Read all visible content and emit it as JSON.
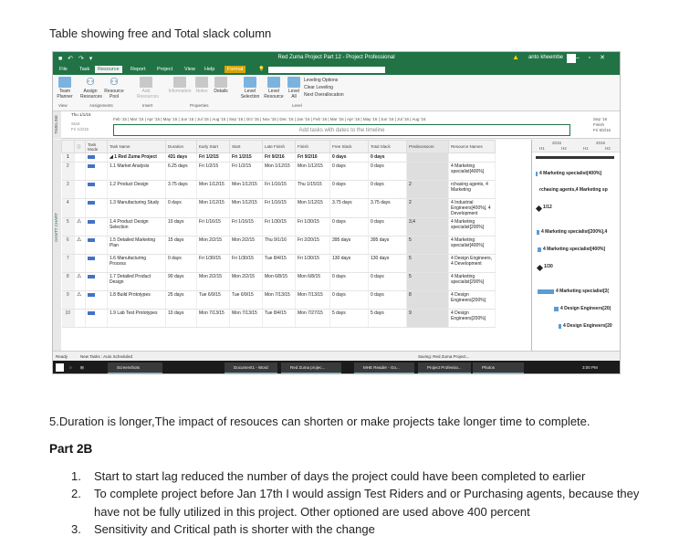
{
  "doc": {
    "title": "Table showing free and Total slack column",
    "question5": "5.Duration is longer,The impact of resouces can shorten or make projects take longer time to complete.",
    "part_heading": "Part 2B",
    "answers": [
      {
        "num": "1.",
        "text": "Start to start lag reduced the number of days the project could have been completed to earlier"
      },
      {
        "num": "2.",
        "text": "To complete project before Jan 17th I would assign Test Riders and or Purchasing agents, because  they have not be fully utilized in this project. Other optioned are used above 400 percent"
      },
      {
        "num": "3.",
        "text": "Sensitivity and Critical path is shorter with the change"
      }
    ]
  },
  "project": {
    "window_title": "Red Zuma Project Part 12 - Project Professional",
    "user": "anto kheembe",
    "menu": [
      "File",
      "Task",
      "Resource",
      "Report",
      "Project",
      "View",
      "Help",
      "Format"
    ],
    "ribbon": {
      "buttons": [
        "Team Planner",
        "Assign Resources",
        "Resource Pool",
        "Add Resources",
        "Information",
        "Notes",
        "Details",
        "Level Selection",
        "Level Resource",
        "Level All"
      ],
      "leveling": [
        "Leveling Options",
        "Clear Leveling",
        "Next Overallocation"
      ],
      "groups": [
        "View",
        "Assignments",
        "Insert",
        "Properties",
        "Level"
      ]
    },
    "timeline": {
      "side_label": "TIMELINE",
      "today": "Thu 1/1/15",
      "start_label": "Start",
      "start_date": "Fri 1/2/15",
      "scale": "Feb '15 | Mar '15 | Apr '15 | May '15 | Jun '15 | Jul '15 | Aug '15 | Sep '15 | Oct '15 | Nov '15 | Dec '15 | Jan '16 | Feb '16 | Mar '16 | Apr '16 | May '16 | Jun '16 | Jul '16 | Aug '16",
      "placeholder": "Add tasks with dates to the timeline",
      "finish_month": "Sep '16",
      "finish_label": "Finish",
      "finish_date": "Fri 9/2/16"
    },
    "gantt_side_label": "GANTT CHART",
    "columns": [
      "",
      "",
      "Task Mode",
      "Task Name",
      "Duration",
      "Early Start",
      "Start",
      "Late Finish",
      "Finish",
      "Free Slack",
      "Total Slack",
      "Predecessors",
      "Resource Names"
    ],
    "rows": [
      {
        "id": "1",
        "ind": "",
        "name": "◢ 1 Red Zuma Project",
        "dur": "431 days",
        "es": "Fri 1/2/15",
        "start": "Fri 1/2/15",
        "lf": "Fri 9/2/16",
        "finish": "Fri 9/2/16",
        "fs": "0 days",
        "ts": "0 days",
        "pred": "",
        "res": ""
      },
      {
        "id": "2",
        "ind": "",
        "name": "1.1 Market Analysis",
        "dur": "6.25 days",
        "es": "Fri 1/2/15",
        "start": "Fri 1/2/15",
        "lf": "Mon 1/12/15",
        "finish": "Mon 1/12/15",
        "fs": "0 days",
        "ts": "0 days",
        "pred": "",
        "res": "4 Marketing specialist[400%]"
      },
      {
        "id": "3",
        "ind": "",
        "name": "1.2 Product Design",
        "dur": "3.75 days",
        "es": "Mon 1/12/15",
        "start": "Mon 1/12/15",
        "lf": "Fri 1/16/15",
        "finish": "Thu 1/15/15",
        "fs": "0 days",
        "ts": "0 days",
        "pred": "2",
        "res": "rchasing agents, 4 Marketing"
      },
      {
        "id": "4",
        "ind": "",
        "name": "1.3 Manufacturing Study",
        "dur": "0 days",
        "es": "Mon 1/12/15",
        "start": "Mon 1/12/15",
        "lf": "Fri 1/16/15",
        "finish": "Mon 1/12/15",
        "fs": "3.75 days",
        "ts": "3.75 days",
        "pred": "2",
        "res": "4 Industrial Engineers[400%], 4 Development"
      },
      {
        "id": "5",
        "ind": "⚠",
        "name": "1.4 Product Design Selection",
        "dur": "10 days",
        "es": "Fri 1/16/15",
        "start": "Fri 1/16/15",
        "lf": "Fri 1/30/15",
        "finish": "Fri 1/30/15",
        "fs": "0 days",
        "ts": "0 days",
        "pred": "3,4",
        "res": "4 Marketing specialist[200%]"
      },
      {
        "id": "6",
        "ind": "⚠",
        "name": "1.5 Detailed Marketing Plan",
        "dur": "15 days",
        "es": "Mon 2/2/15",
        "start": "Mon 2/2/15",
        "lf": "Thu 9/1/16",
        "finish": "Fri 2/20/15",
        "fs": "395 days",
        "ts": "395 days",
        "pred": "5",
        "res": "4 Marketing specialist[400%]"
      },
      {
        "id": "7",
        "ind": "",
        "name": "1.6 Manufacturing Process",
        "dur": "0 days",
        "es": "Fri 1/30/15",
        "start": "Fri 1/30/15",
        "lf": "Tue 8/4/15",
        "finish": "Fri 1/30/15",
        "fs": "130 days",
        "ts": "130 days",
        "pred": "5",
        "res": "4 Design Engineers, 4 Development"
      },
      {
        "id": "8",
        "ind": "⚠",
        "name": "1.7 Detailed Product Design",
        "dur": "90 days",
        "es": "Mon 2/2/15",
        "start": "Mon 2/2/15",
        "lf": "Mon 6/8/15",
        "finish": "Mon 6/8/15",
        "fs": "0 days",
        "ts": "0 days",
        "pred": "5",
        "res": "4 Marketing specialist[200%]"
      },
      {
        "id": "9",
        "ind": "⚠",
        "name": "1.8 Build Prototypes",
        "dur": "25 days",
        "es": "Tue 6/9/15",
        "start": "Tue 6/9/15",
        "lf": "Mon 7/13/15",
        "finish": "Mon 7/13/15",
        "fs": "0 days",
        "ts": "0 days",
        "pred": "8",
        "res": "4 Design Engineers[200%]"
      },
      {
        "id": "10",
        "ind": "",
        "name": "1.9 Lab Test Prototypes",
        "dur": "10 days",
        "es": "Mon 7/13/15",
        "start": "Mon 7/13/15",
        "lf": "Tue 8/4/15",
        "finish": "Mon 7/27/15",
        "fs": "5 days",
        "ts": "5 days",
        "pred": "9",
        "res": "4 Design Engineers[200%]"
      }
    ],
    "chart_header": {
      "years": [
        "2015",
        "2016"
      ],
      "halves": [
        "H1",
        "H2",
        "H1",
        "H2"
      ]
    },
    "chart_labels": [
      "4 Marketing specialist[400%]",
      "rchasing agents,4 Marketing sp",
      "1/12",
      "4 Marketing specialist[200%],4",
      "4 Marketing specialist[400%]",
      "1/30",
      "4 Marketing specialist[2(",
      "4 Design Engineers[20(",
      "4 Design Engineers[20"
    ],
    "status": {
      "ready": "Ready",
      "new_tasks": "New Tasks : Auto Scheduled",
      "saving": "Saving: Red Zuma Project..."
    },
    "taskbar": [
      "Screenshots",
      "Document1 - Word",
      "Red Zuma projec...",
      "MHE Reader - Go...",
      "Project Professio...",
      "Photos",
      "3:00 PM"
    ]
  }
}
